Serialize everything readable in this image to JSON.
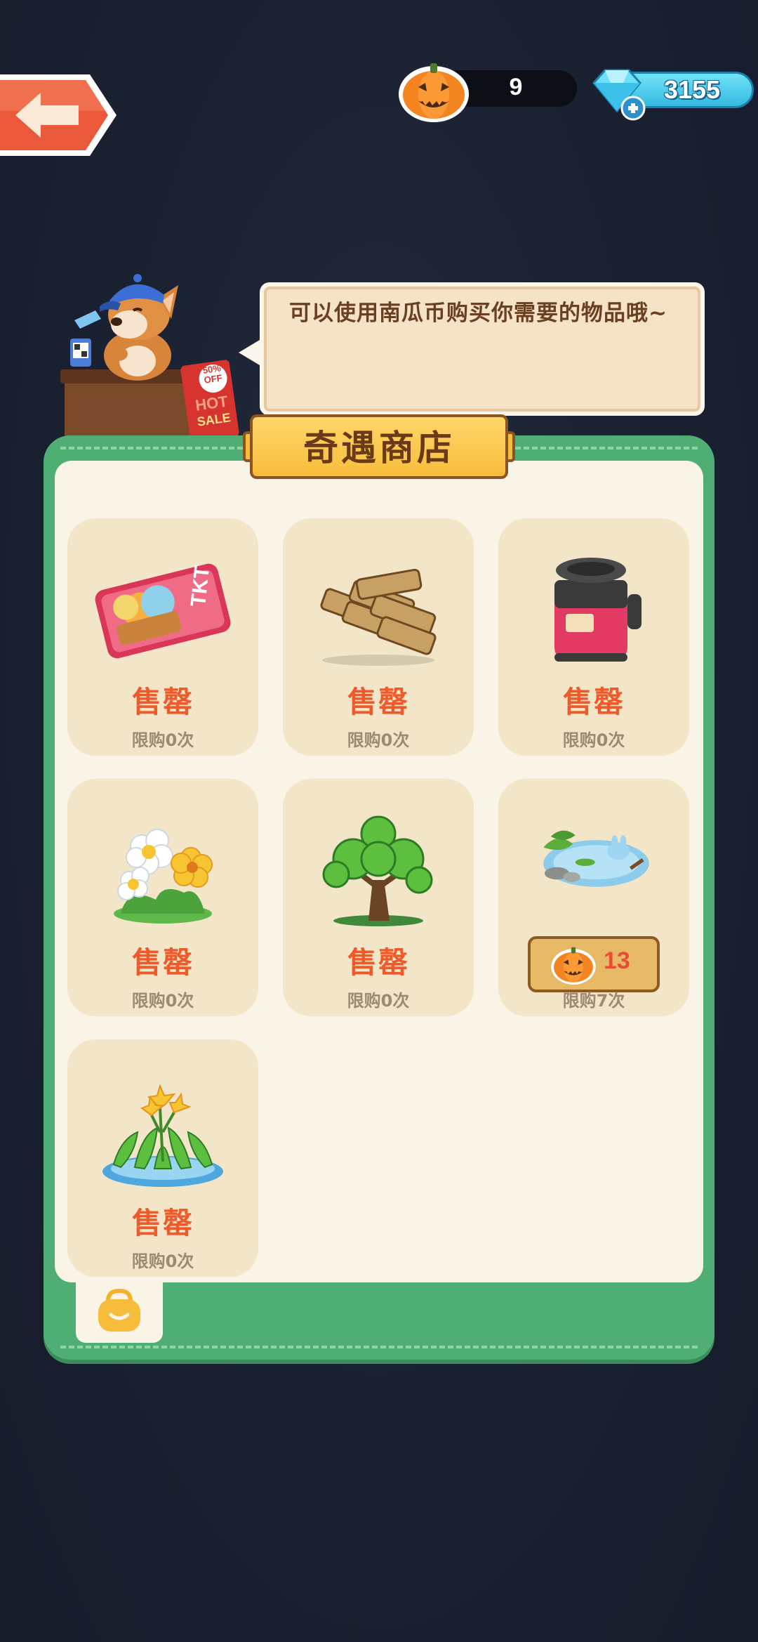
{
  "header": {
    "pumpkin_count": "9",
    "gem_count": "3155"
  },
  "merchant": {
    "speech": "可以使用南瓜币购买你需要的物品哦~",
    "sign_percent": "50%",
    "sign_off": "OFF",
    "sign_hot": "HOT",
    "sign_sale": "SALE"
  },
  "shop": {
    "title": "奇遇商店",
    "items": [
      {
        "name": "ticket",
        "status": "售罄",
        "limit": "限购0次"
      },
      {
        "name": "wood",
        "status": "售罄",
        "limit": "限购0次"
      },
      {
        "name": "jar",
        "status": "售罄",
        "limit": "限购0次"
      },
      {
        "name": "flowers",
        "status": "售罄",
        "limit": "限购0次"
      },
      {
        "name": "tree",
        "status": "售罄",
        "limit": "限购0次"
      },
      {
        "name": "pond",
        "price": "13",
        "limit": "限购7次"
      },
      {
        "name": "lilies",
        "status": "售罄",
        "limit": "限购0次"
      }
    ]
  },
  "ticket_label": "TKT",
  "colors": {
    "panel_green": "#4fae73",
    "sold_out_red": "#ef5a2b",
    "title_gold": "#f7bd3a"
  },
  "icons": [
    "back-arrow-icon",
    "pumpkin-coin-icon",
    "gem-plus-icon",
    "bag-icon"
  ]
}
